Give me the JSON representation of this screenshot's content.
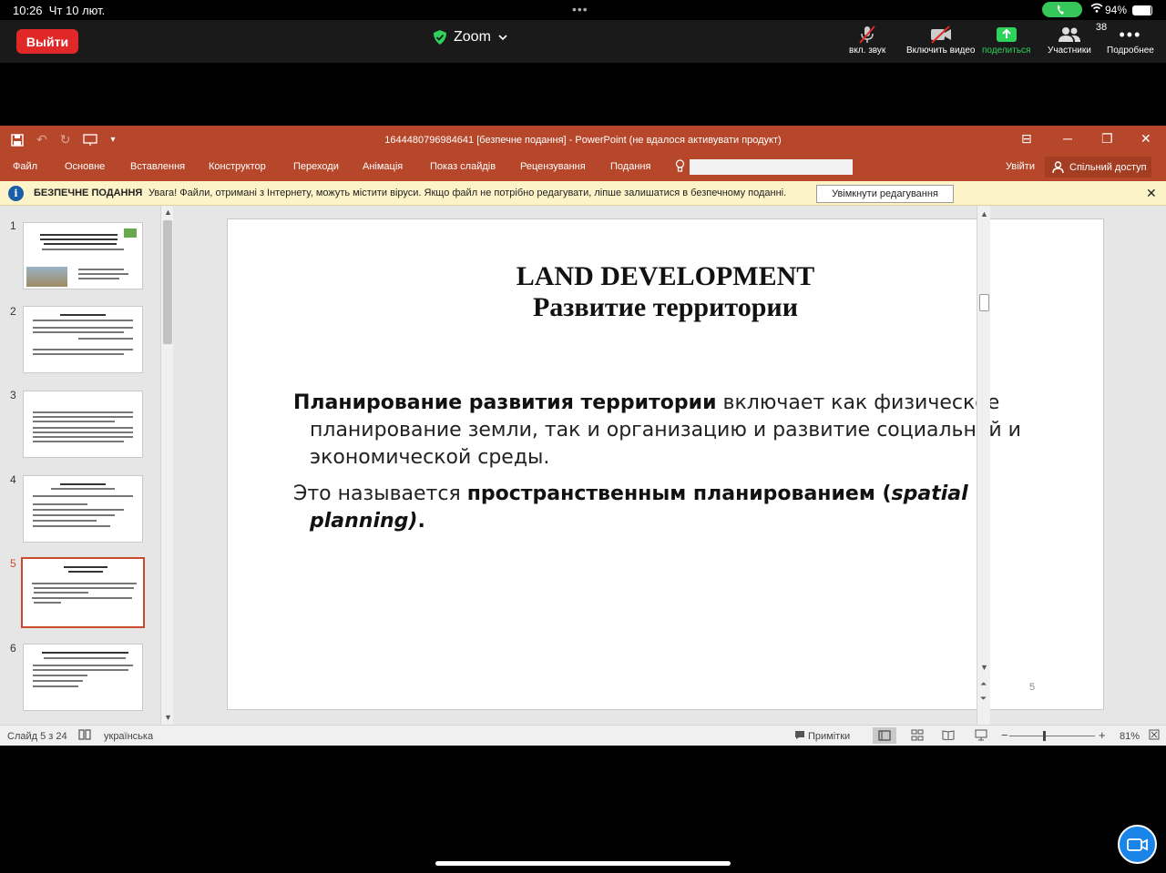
{
  "status_bar": {
    "time": "10:26",
    "date": "Чт 10 лют.",
    "battery": "94%",
    "battery_level": 0.94
  },
  "zoom": {
    "leave_label": "Выйти",
    "app_title": "Zoom",
    "buttons": {
      "mic": "вкл. звук",
      "video": "Включить видео",
      "share": "поделиться",
      "participants": "Участники",
      "participants_count": "38",
      "more": "Подробнее"
    },
    "colors": {
      "leave": "#e02828",
      "share": "#2fd25a",
      "call": "#35c759",
      "fab": "#1b84e8"
    }
  },
  "ppt": {
    "title": "1644480796984641 [безпечне подання] - PowerPoint (не вдалося активувати продукт)",
    "tabs": [
      "Файл",
      "Основне",
      "Вставлення",
      "Конструктор",
      "Переходи",
      "Анімація",
      "Показ слайдів",
      "Рецензування",
      "Подання"
    ],
    "sign_in": "Увійти",
    "share": "Спільний доступ",
    "accent": "#b7472a",
    "protected_view": {
      "label": "БЕЗПЕЧНЕ ПОДАННЯ",
      "message": "Увага! Файли, отримані з Інтернету, можуть містити віруси. Якщо файл не потрібно редагувати, ліпше залишатися в безпечному поданні.",
      "button": "Увімкнути редагування"
    },
    "thumbnails": [
      "1",
      "2",
      "3",
      "4",
      "5",
      "6"
    ],
    "active_slide": 5,
    "slide": {
      "title_line1": "LAND DEVELOPMENT",
      "title_line2": "Развитие территории",
      "p1_bold": "Планирование развития территории",
      "p1_rest": " включает как физическое планирование земли, так и организацию и развитие социальной и экономической среды.",
      "p2_start": "Это называется ",
      "p2_bold": "пространственным планированием (",
      "p2_italic": "spatial planning)",
      "p2_end": ".",
      "number": "5"
    },
    "status": {
      "slide_of": "Слайд 5 з 24",
      "language": "українська",
      "notes": "Примітки",
      "zoom": "81%"
    }
  }
}
